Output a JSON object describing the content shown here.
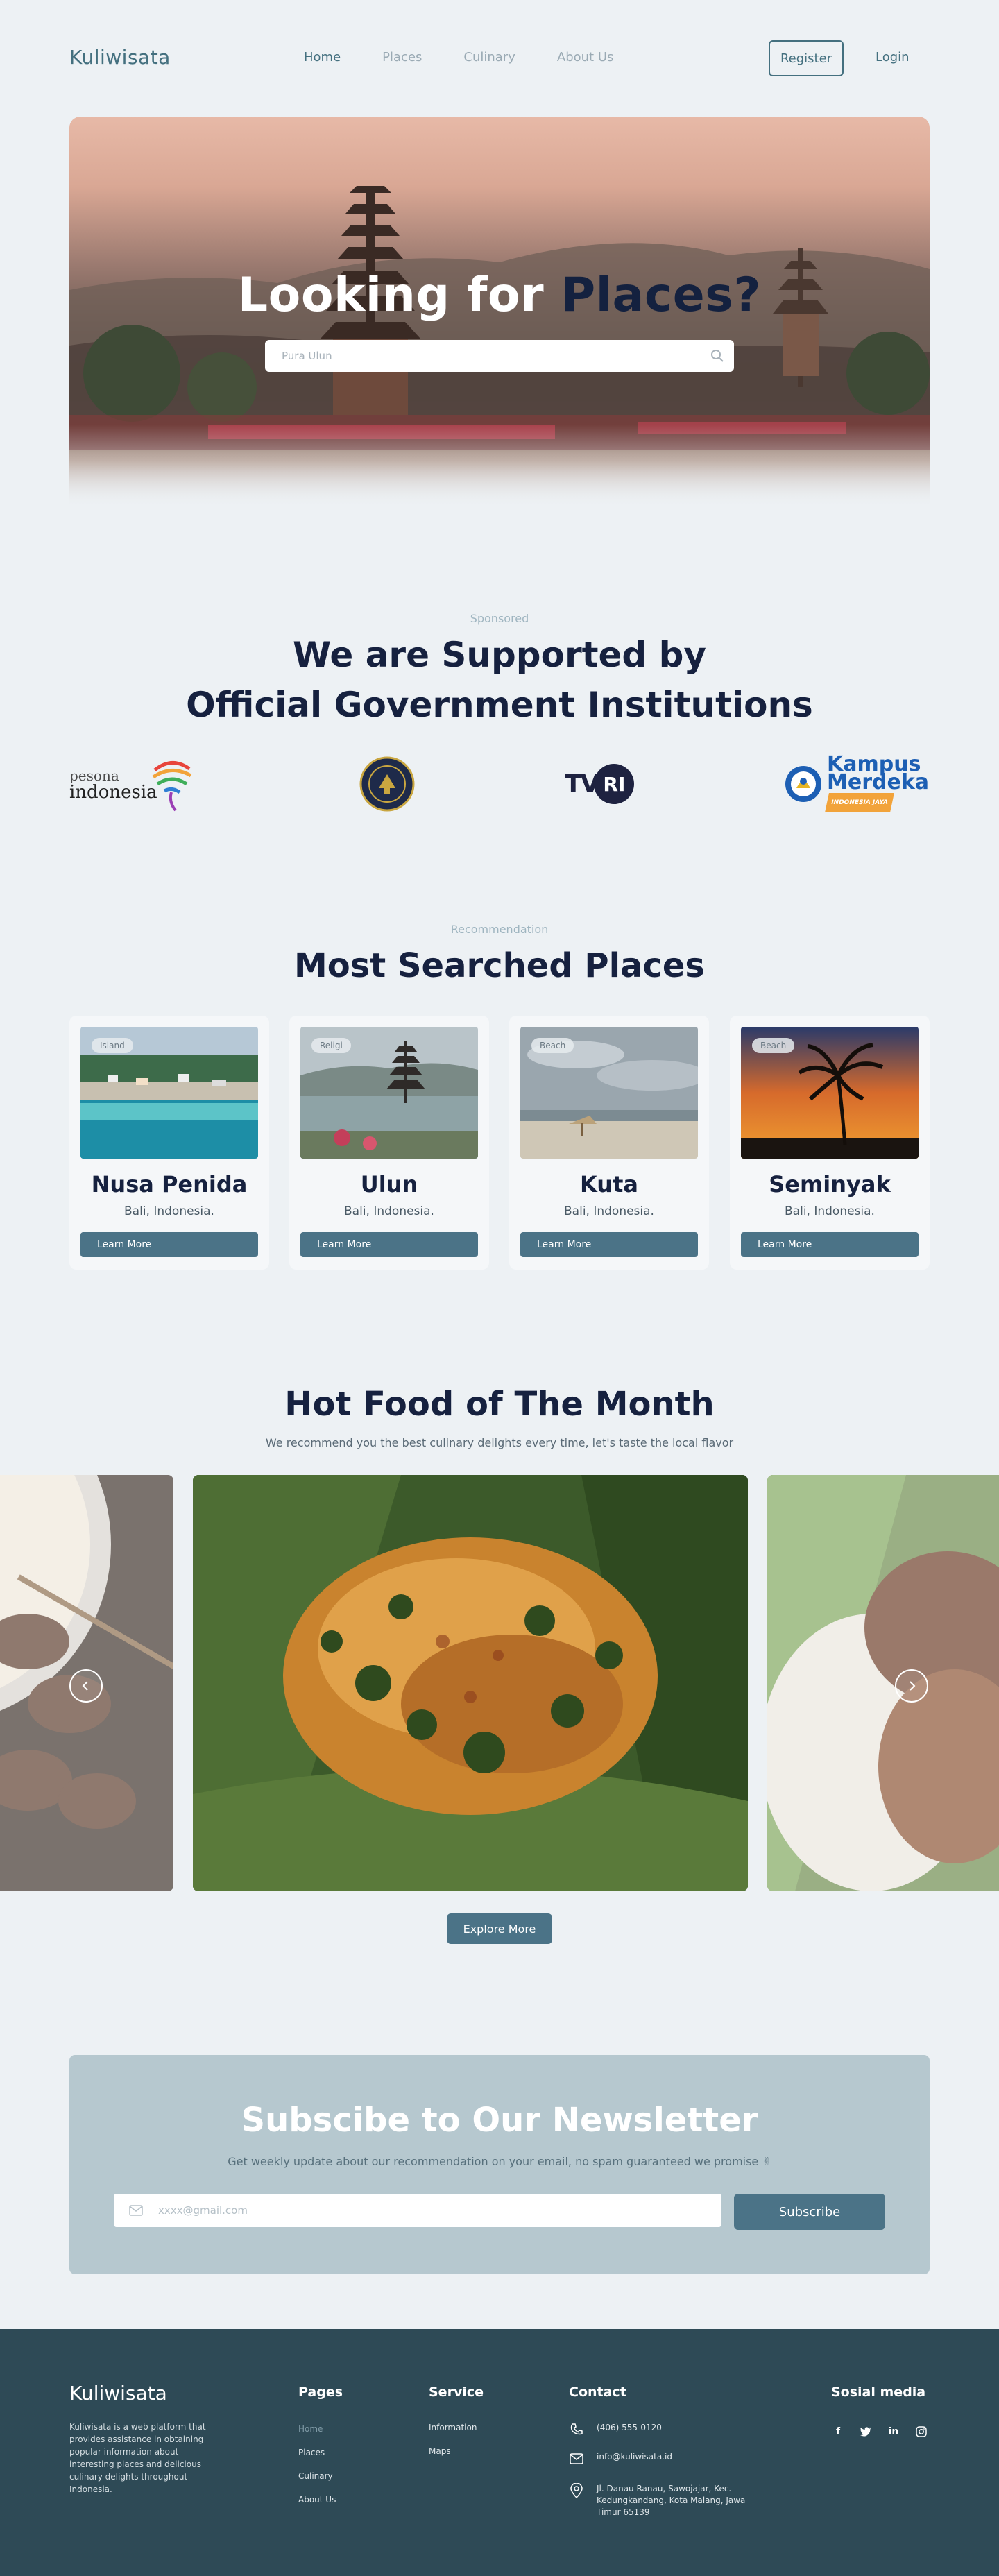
{
  "brand": {
    "name": "Kuliwisata"
  },
  "nav": {
    "links": [
      {
        "label": "Home",
        "active": true
      },
      {
        "label": "Places",
        "active": false
      },
      {
        "label": "Culinary",
        "active": false
      },
      {
        "label": "About Us",
        "active": false
      }
    ],
    "register_label": "Register",
    "login_label": "Login"
  },
  "hero": {
    "title_white": "Looking for",
    "title_accent": "Places?",
    "search_placeholder": "Pura Ulun"
  },
  "sponsors": {
    "label": "Sponsored",
    "title_line1": "We are Supported by",
    "title_line2": "Official Government Institutions",
    "logos": [
      {
        "name": "pesona indonesia",
        "top": "pesona",
        "bottom": "indonesia"
      },
      {
        "name": "government emblem"
      },
      {
        "name": "TVRI",
        "text_a": "TV",
        "text_b": "RI"
      },
      {
        "name": "Kampus Merdeka",
        "line1": "Kampus",
        "line2": "Merdeka",
        "line3": "INDONESIA JAYA"
      }
    ]
  },
  "recommendation": {
    "label": "Recommendation",
    "title": "Most Searched Places",
    "cards": [
      {
        "tag": "Island",
        "name": "Nusa Penida",
        "location": "Bali, Indonesia.",
        "button": "Learn More"
      },
      {
        "tag": "Religi",
        "name": "Ulun",
        "location": "Bali, Indonesia.",
        "button": "Learn More"
      },
      {
        "tag": "Beach",
        "name": "Kuta",
        "location": "Bali, Indonesia.",
        "button": "Learn More"
      },
      {
        "tag": "Beach",
        "name": "Seminyak",
        "location": "Bali, Indonesia.",
        "button": "Learn More"
      }
    ]
  },
  "food": {
    "title": "Hot Food of The Month",
    "subtitle": "We recommend you the best culinary delights every time, let's taste the local flavor",
    "explore_label": "Explore More"
  },
  "newsletter": {
    "title": "Subscibe to Our Newsletter",
    "subtitle": "Get weekly update about our recommendation on your email, no spam guaranteed we promise ✌",
    "email_placeholder": "xxxx@gmail.com",
    "subscribe_label": "Subscribe"
  },
  "footer": {
    "logo": "Kuliwisata",
    "description": "Kuliwisata is a web platform that provides assistance in obtaining popular information about interesting places and delicious culinary delights throughout Indonesia.",
    "pages_title": "Pages",
    "pages": [
      "Home",
      "Places",
      "Culinary",
      "About Us"
    ],
    "service_title": "Service",
    "services": [
      "Information",
      "Maps"
    ],
    "contact_title": "Contact",
    "phone": "(406) 555-0120",
    "email": "info@kuliwisata.id",
    "address": "Jl. Danau Ranau, Sawojajar, Kec. Kedungkandang, Kota Malang, Jawa Timur 65139",
    "social_title": "Sosial media",
    "social": [
      "facebook-icon",
      "twitter-icon",
      "linkedin-icon",
      "instagram-icon"
    ]
  },
  "colors": {
    "primary": "#4b7387",
    "navy": "#16213f",
    "background": "#edf1f4",
    "footer": "#2e4a56",
    "newsletter": "#b6c8cf"
  }
}
